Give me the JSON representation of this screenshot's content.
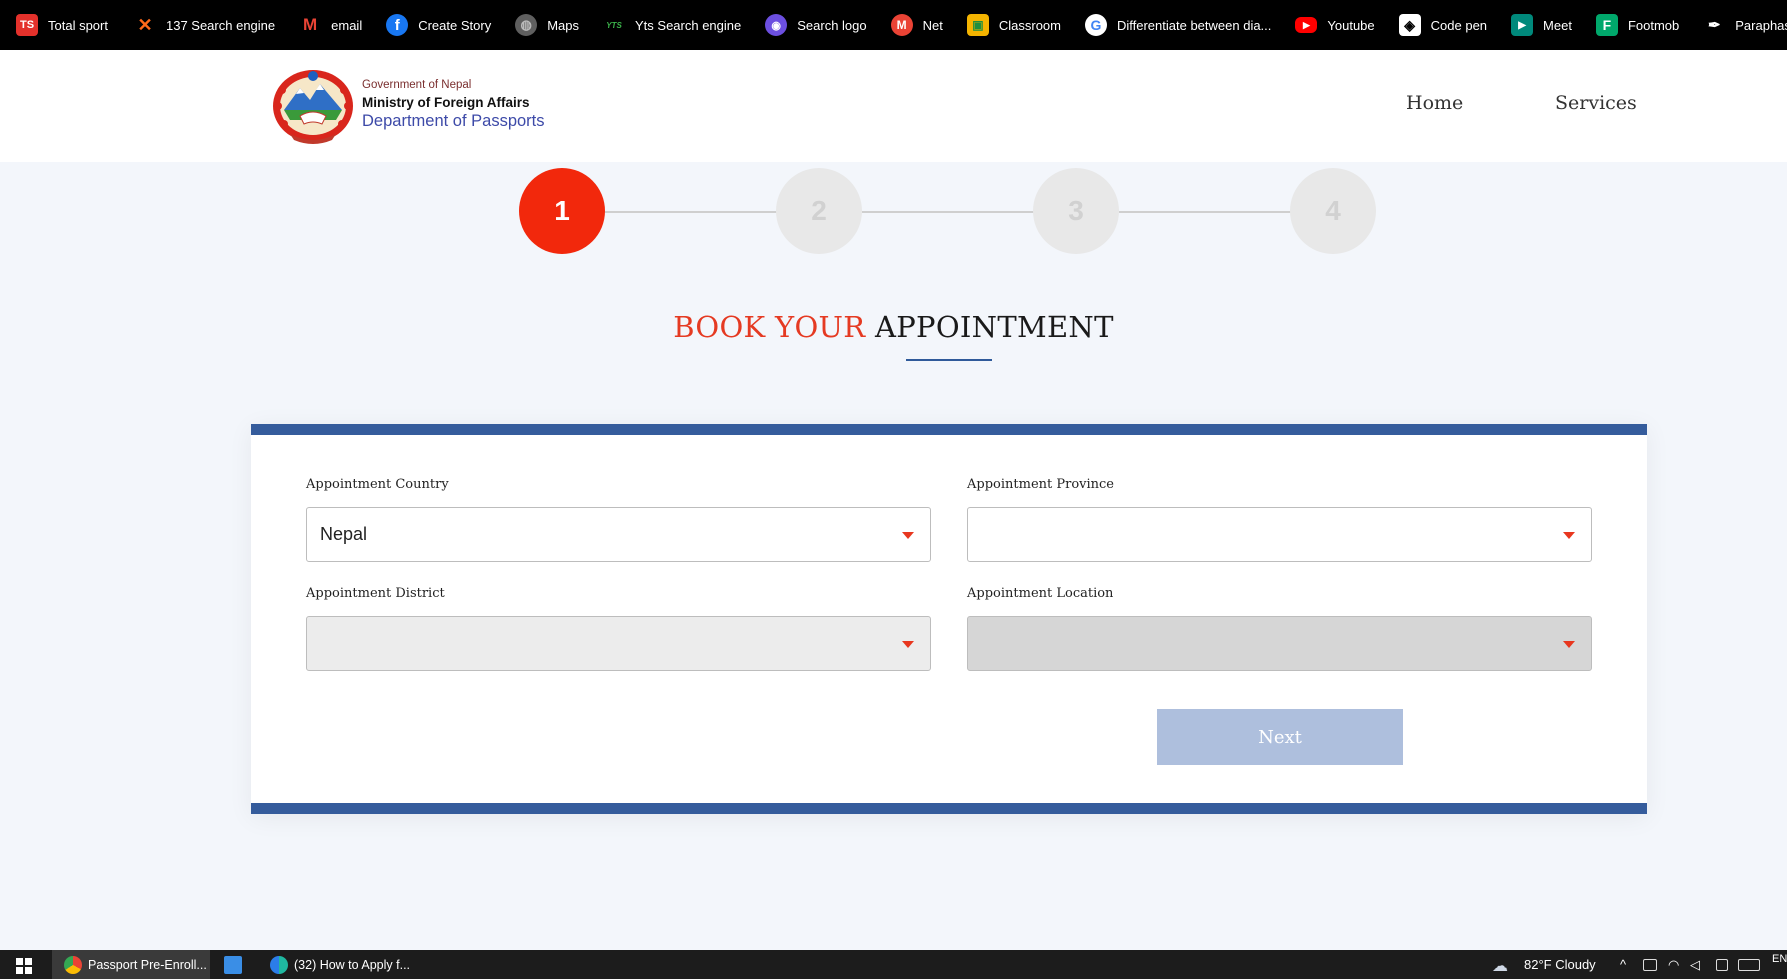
{
  "bookmarks": [
    {
      "label": "Total sport",
      "icon": "ts-logo-icon",
      "color": "#e4312b",
      "glyph": "TS"
    },
    {
      "label": "137 Search engine",
      "icon": "x-logo-icon",
      "color": "#000000",
      "glyph": "X"
    },
    {
      "label": "email",
      "icon": "gmail-icon",
      "color": "#000000",
      "glyph": "M"
    },
    {
      "label": "Create Story",
      "icon": "facebook-icon",
      "color": "#1877f2",
      "glyph": "f"
    },
    {
      "label": "Maps",
      "icon": "globe-icon",
      "color": "#555555",
      "glyph": "◍"
    },
    {
      "label": "Yts Search engine",
      "icon": "yts-icon",
      "color": "#000000",
      "glyph": "YTS"
    },
    {
      "label": "Search logo",
      "icon": "search-logo-icon",
      "color": "#6c4fe0",
      "glyph": "◉"
    },
    {
      "label": "Net",
      "icon": "net-icon",
      "color": "#ea4335",
      "glyph": "M"
    },
    {
      "label": "Classroom",
      "icon": "classroom-icon",
      "color": "#f4b400",
      "glyph": "▣"
    },
    {
      "label": "Differentiate between dia...",
      "icon": "google-icon",
      "color": "#ffffff",
      "glyph": "G"
    },
    {
      "label": "Youtube",
      "icon": "youtube-icon",
      "color": "#ff0000",
      "glyph": "▶"
    },
    {
      "label": "Code pen",
      "icon": "codepen-icon",
      "color": "#ffffff",
      "glyph": "◈"
    },
    {
      "label": "Meet",
      "icon": "meet-icon",
      "color": "#00897b",
      "glyph": "▶"
    },
    {
      "label": "Footmob",
      "icon": "fotmob-icon",
      "color": "#00a86b",
      "glyph": "F"
    },
    {
      "label": "Paraphase",
      "icon": "quill-icon",
      "color": "#000000",
      "glyph": "✒"
    }
  ],
  "header": {
    "gov_line": "Government of Nepal",
    "ministry_line": "Ministry of Foreign Affairs",
    "department_line": "Department of Passports",
    "nav": {
      "home": "Home",
      "services": "Services"
    }
  },
  "stepper": {
    "steps": [
      "1",
      "2",
      "3",
      "4"
    ],
    "active_step": 1,
    "active_color": "#f2280c"
  },
  "title": {
    "highlight": "BOOK YOUR",
    "rest": "APPOINTMENT"
  },
  "form": {
    "country": {
      "label": "Appointment Country",
      "value": "Nepal"
    },
    "province": {
      "label": "Appointment Province",
      "value": ""
    },
    "district": {
      "label": "Appointment District",
      "value": ""
    },
    "location": {
      "label": "Appointment Location",
      "value": ""
    },
    "next_label": "Next",
    "accent_color": "#355c9c"
  },
  "taskbar": {
    "apps": [
      {
        "label": "Passport Pre-Enroll..."
      },
      {
        "label": ""
      },
      {
        "label": "(32) How to Apply f..."
      }
    ],
    "weather": "82°F  Cloudy",
    "lang": "EN"
  }
}
